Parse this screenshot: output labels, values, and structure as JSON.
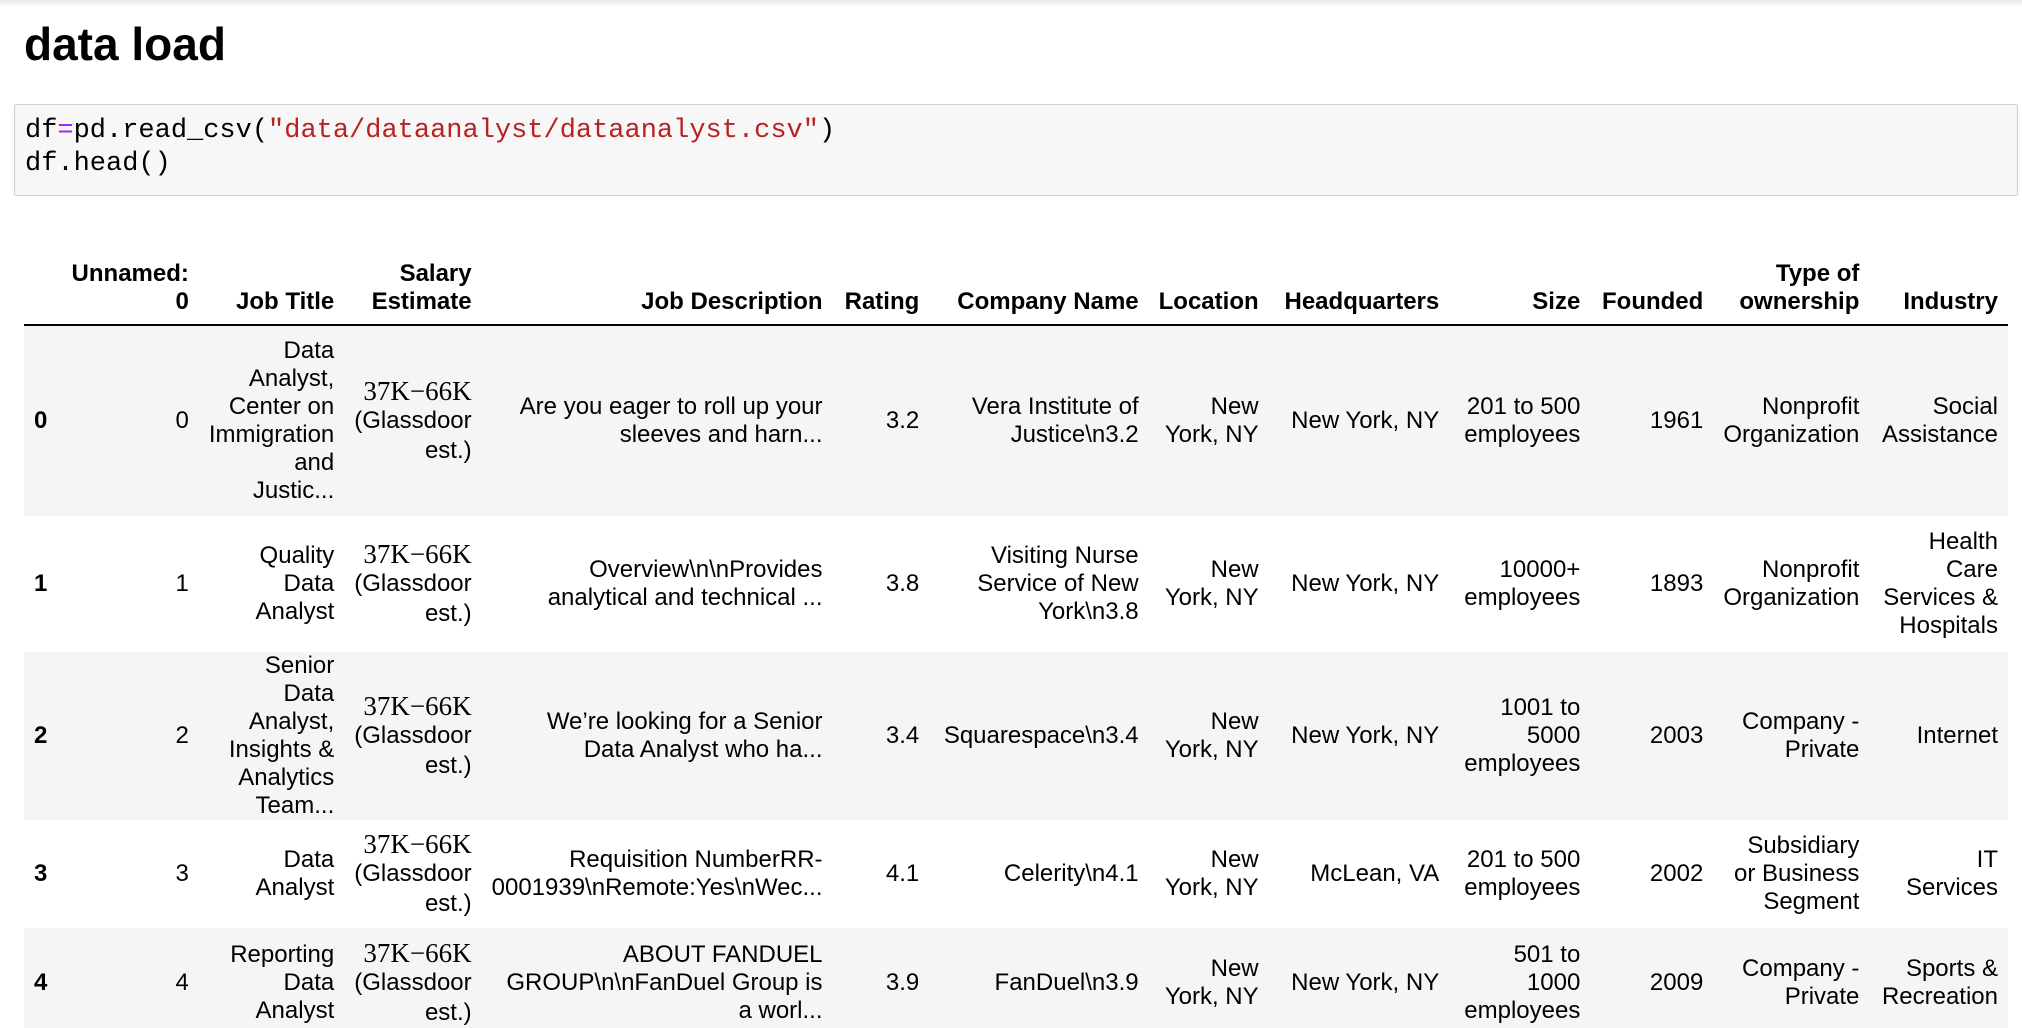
{
  "section": {
    "title": "data load"
  },
  "code": {
    "var": "df",
    "op": "=",
    "call_open": "pd.read_csv(",
    "path": "\"data/dataanalyst/dataanalyst.csv\"",
    "call_close": ")",
    "line2": "df.head()"
  },
  "table": {
    "columns": [
      "",
      "Unnamed: 0",
      "Job Title",
      "Salary Estimate",
      "Job Description",
      "Rating",
      "Company Name",
      "Location",
      "Headquarters",
      "Size",
      "Founded",
      "Type of ownership",
      "Industry"
    ],
    "rows": [
      {
        "index": "0",
        "unnamed": "0",
        "job_title": "Data Analyst, Center on Immigration and Justic...",
        "salary_math": "37K−66K",
        "salary_rest": "(Glassdoor est.)",
        "job_description": "Are you eager to roll up your sleeves and harn...",
        "rating": "3.2",
        "company_name": "Vera Institute of Justice\\n3.2",
        "location": "New York, NY",
        "headquarters": "New York, NY",
        "size": "201 to 500 employees",
        "founded": "1961",
        "ownership": "Nonprofit Organization",
        "industry": "Social Assistance"
      },
      {
        "index": "1",
        "unnamed": "1",
        "job_title": "Quality Data Analyst",
        "salary_math": "37K−66K",
        "salary_rest": "(Glassdoor est.)",
        "job_description": "Overview\\n\\nProvides analytical and technical ...",
        "rating": "3.8",
        "company_name": "Visiting Nurse Service of New York\\n3.8",
        "location": "New York, NY",
        "headquarters": "New York, NY",
        "size": "10000+ employees",
        "founded": "1893",
        "ownership": "Nonprofit Organization",
        "industry": "Health Care Services & Hospitals"
      },
      {
        "index": "2",
        "unnamed": "2",
        "job_title": "Senior Data Analyst, Insights & Analytics Team...",
        "salary_math": "37K−66K",
        "salary_rest": "(Glassdoor est.)",
        "job_description": "We’re looking for a Senior Data Analyst who ha...",
        "rating": "3.4",
        "company_name": "Squarespace\\n3.4",
        "location": "New York, NY",
        "headquarters": "New York, NY",
        "size": "1001 to 5000 employees",
        "founded": "2003",
        "ownership": "Company - Private",
        "industry": "Internet"
      },
      {
        "index": "3",
        "unnamed": "3",
        "job_title": "Data Analyst",
        "salary_math": "37K−66K",
        "salary_rest": "(Glassdoor est.)",
        "job_description": "Requisition NumberRR-0001939\\nRemote:Yes\\nWec...",
        "rating": "4.1",
        "company_name": "Celerity\\n4.1",
        "location": "New York, NY",
        "headquarters": "McLean, VA",
        "size": "201 to 500 employees",
        "founded": "2002",
        "ownership": "Subsidiary or Business Segment",
        "industry": "IT Services"
      },
      {
        "index": "4",
        "unnamed": "4",
        "job_title": "Reporting Data Analyst",
        "salary_math": "37K−66K",
        "salary_rest": "(Glassdoor est.)",
        "job_description": "ABOUT FANDUEL GROUP\\n\\nFanDuel Group is a worl...",
        "rating": "3.9",
        "company_name": "FanDuel\\n3.9",
        "location": "New York, NY",
        "headquarters": "New York, NY",
        "size": "501 to 1000 employees",
        "founded": "2009",
        "ownership": "Company - Private",
        "industry": "Sports & Recreation"
      }
    ]
  }
}
